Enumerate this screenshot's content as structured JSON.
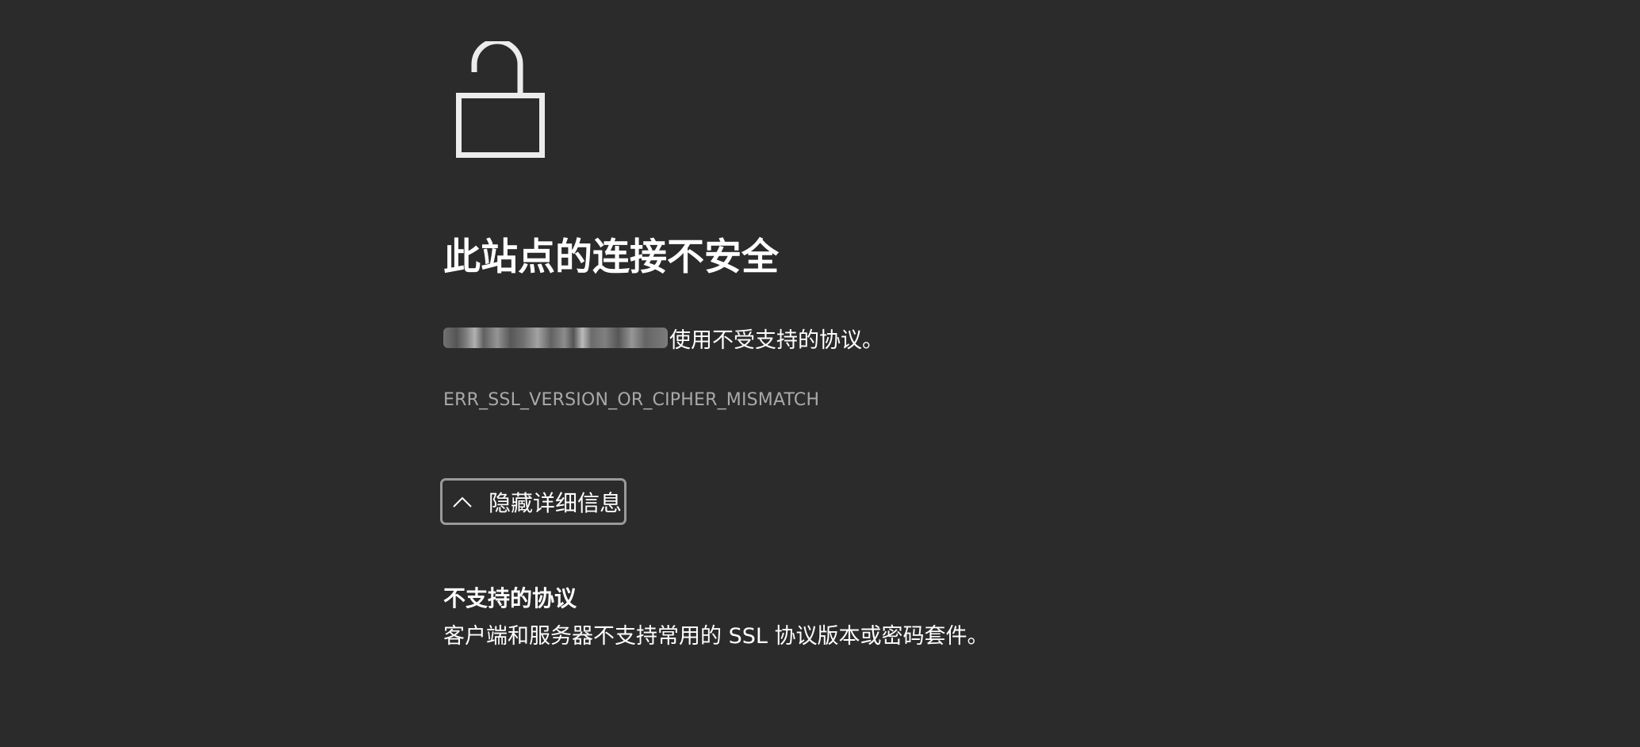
{
  "error_page": {
    "title": "此站点的连接不安全",
    "description_suffix": "使用不受支持的协议。",
    "error_code": "ERR_SSL_VERSION_OR_CIPHER_MISMATCH",
    "toggle_details_label": "隐藏详细信息",
    "details": {
      "heading": "不支持的协议",
      "text": "客户端和服务器不支持常用的 SSL 协议版本或密码套件。"
    }
  },
  "icons": {
    "lock": "unlocked-padlock-icon",
    "toggle": "chevron-up-icon"
  },
  "colors": {
    "background": "#2b2b2b",
    "text": "#ffffff",
    "muted_text": "#a9a9a9",
    "button_border": "#9a9a9a"
  }
}
